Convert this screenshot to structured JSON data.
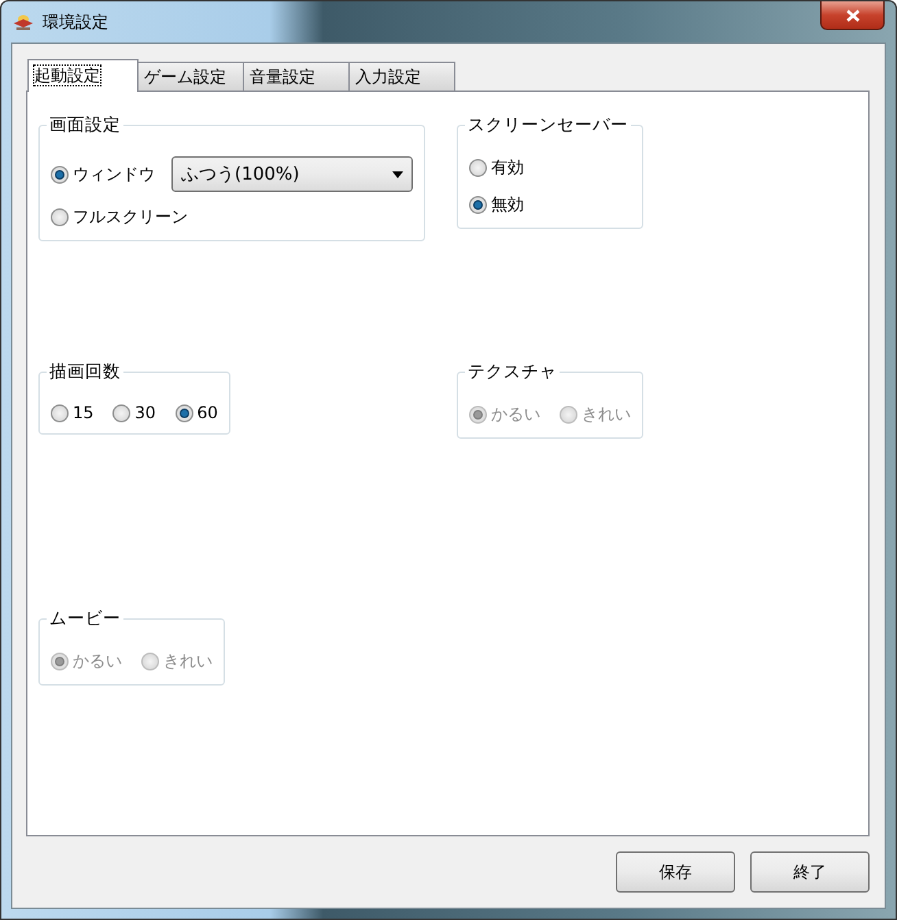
{
  "window": {
    "title": "環境設定"
  },
  "tabs": [
    {
      "label": "起動設定",
      "selected": true
    },
    {
      "label": "ゲーム設定",
      "selected": false
    },
    {
      "label": "音量設定",
      "selected": false
    },
    {
      "label": "入力設定",
      "selected": false
    }
  ],
  "groups": [
    {
      "title": "画面設定",
      "kind": "stacked",
      "disabled": false,
      "options": [
        {
          "label": "ウィンドウ",
          "selected": true,
          "dropdown": {
            "value": "ふつう(100%)"
          }
        },
        {
          "label": "フルスクリーン",
          "selected": false
        }
      ]
    },
    {
      "title": "スクリーンセーバー",
      "kind": "stacked",
      "disabled": false,
      "options": [
        {
          "label": "有効",
          "selected": false
        },
        {
          "label": "無効",
          "selected": true
        }
      ]
    },
    {
      "title": "描画回数",
      "kind": "inline",
      "disabled": false,
      "options": [
        {
          "label": "15",
          "selected": false
        },
        {
          "label": "30",
          "selected": false
        },
        {
          "label": "60",
          "selected": true
        }
      ]
    },
    {
      "title": "テクスチャ",
      "kind": "inline",
      "disabled": true,
      "options": [
        {
          "label": "かるい",
          "selected": true
        },
        {
          "label": "きれい",
          "selected": false
        }
      ]
    },
    {
      "title": "ムービー",
      "kind": "inline",
      "disabled": true,
      "options": [
        {
          "label": "かるい",
          "selected": true
        },
        {
          "label": "きれい",
          "selected": false
        }
      ]
    }
  ],
  "buttons": [
    "保存",
    "終了"
  ]
}
